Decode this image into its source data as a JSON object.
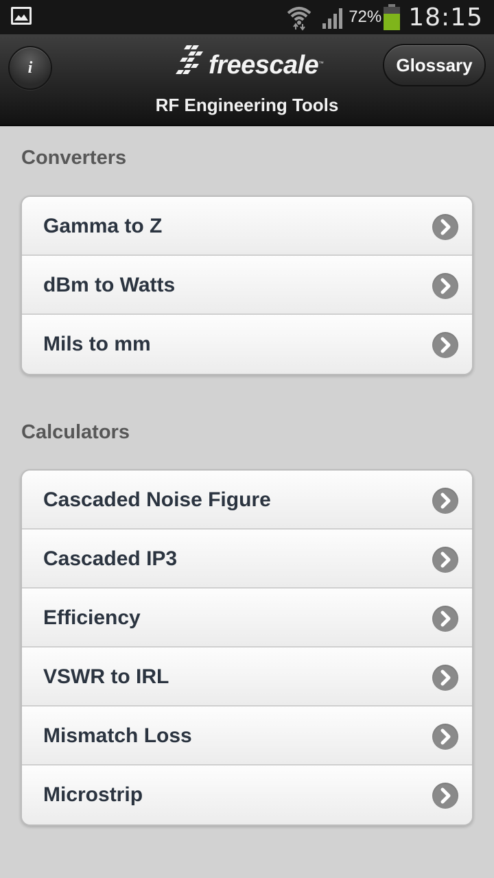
{
  "status_bar": {
    "battery_percent": "72%",
    "time": "18:15",
    "icons": [
      "gallery-icon",
      "wifi-icon",
      "signal-icon",
      "battery-icon"
    ]
  },
  "header": {
    "info_label": "i",
    "logo_text": "freescale",
    "logo_tm": "™",
    "subtitle": "RF Engineering Tools",
    "glossary_label": "Glossary"
  },
  "converters": {
    "title": "Converters",
    "items": [
      {
        "label": "Gamma to Z"
      },
      {
        "label": "dBm to Watts"
      },
      {
        "label": "Mils to mm"
      }
    ]
  },
  "calculators": {
    "title": "Calculators",
    "items": [
      {
        "label": "Cascaded Noise Figure"
      },
      {
        "label": "Cascaded IP3"
      },
      {
        "label": "Efficiency"
      },
      {
        "label": "VSWR to IRL"
      },
      {
        "label": "Mismatch Loss"
      },
      {
        "label": "Microstrip"
      }
    ]
  },
  "colors": {
    "background": "#d2d2d2",
    "header_dark": "#121212",
    "battery_green": "#7fb51b",
    "section_title": "#575757",
    "item_text": "#2b3440",
    "chevron": "#8a8a8a"
  }
}
